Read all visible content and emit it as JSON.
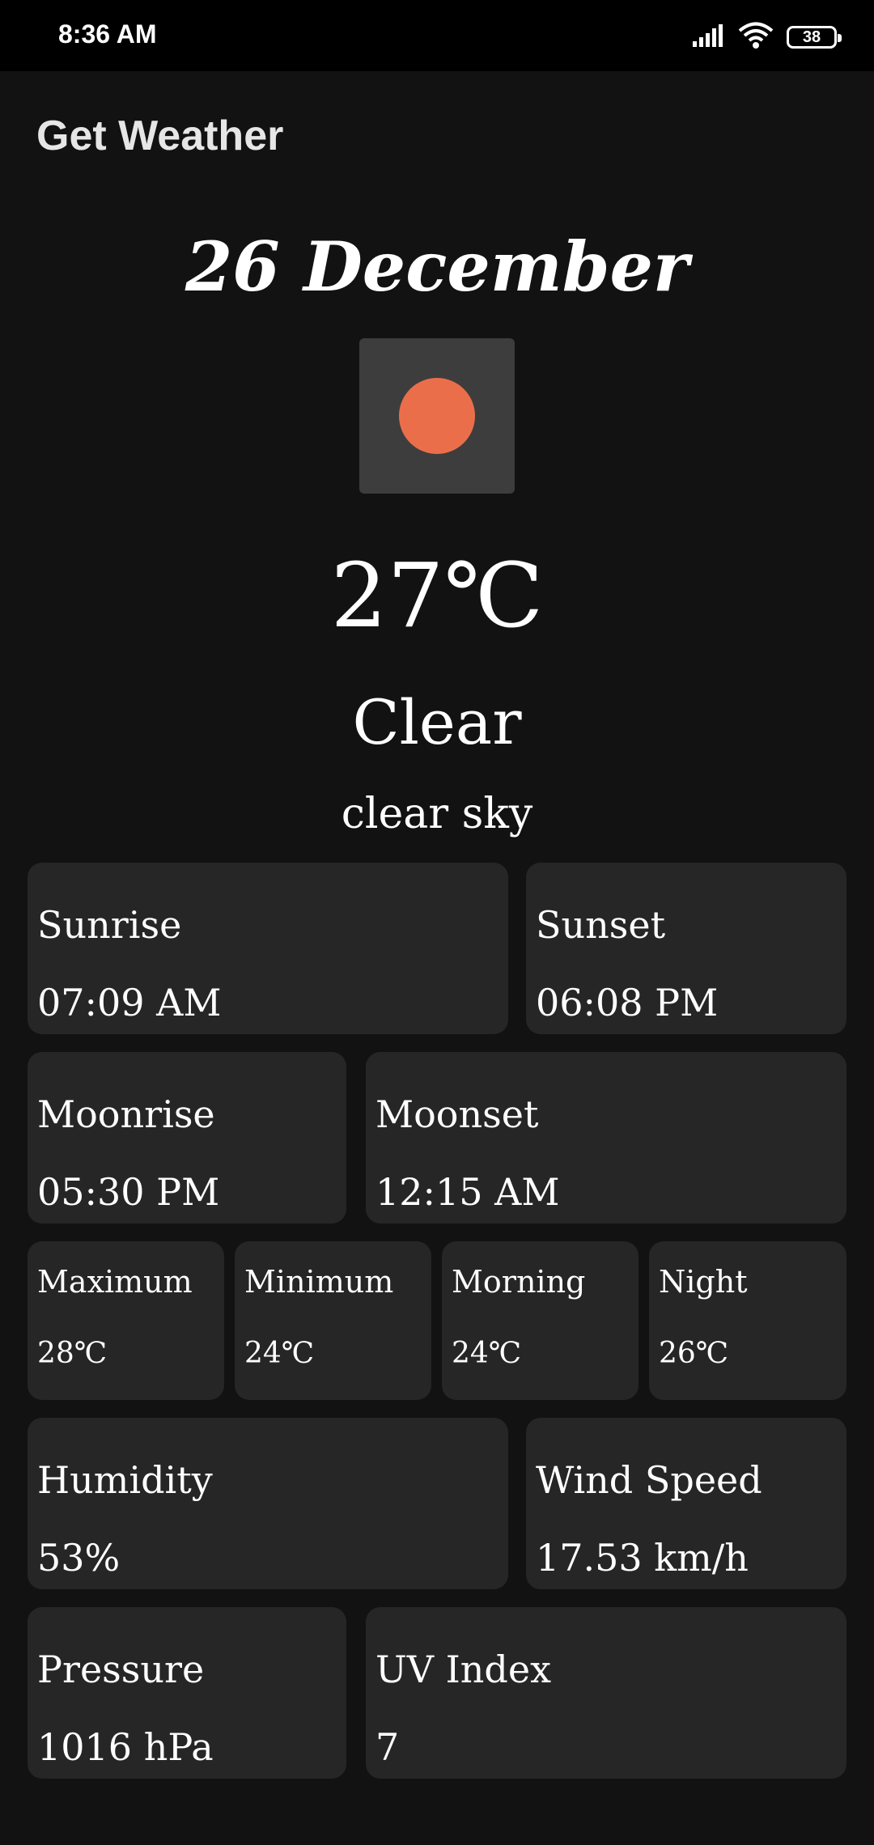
{
  "status_bar": {
    "time": "8:36 AM",
    "battery": "38",
    "icons": [
      "signal-icon",
      "wifi-icon",
      "battery-icon"
    ]
  },
  "app_bar": {
    "title": "Get Weather"
  },
  "weather": {
    "date": "26 December",
    "icon": "clear-sun-icon",
    "temperature": "27℃",
    "condition": "Clear",
    "description": "clear sky"
  },
  "details": {
    "sunrise": {
      "label": "Sunrise",
      "value": "07:09 AM"
    },
    "sunset": {
      "label": "Sunset",
      "value": "06:08 PM"
    },
    "moonrise": {
      "label": "Moonrise",
      "value": "05:30 PM"
    },
    "moonset": {
      "label": "Moonset",
      "value": "12:15 AM"
    },
    "maximum": {
      "label": "Maximum",
      "value": "28℃"
    },
    "minimum": {
      "label": "Minimum",
      "value": "24℃"
    },
    "morning": {
      "label": "Morning",
      "value": "24℃"
    },
    "night": {
      "label": "Night",
      "value": "26℃"
    },
    "humidity": {
      "label": "Humidity",
      "value": "53%"
    },
    "wind_speed": {
      "label": "Wind Speed",
      "value": "17.53 km/h"
    },
    "pressure": {
      "label": "Pressure",
      "value": "1016 hPa"
    },
    "uv_index": {
      "label": "UV Index",
      "value": "7"
    }
  },
  "colors": {
    "background": "#121212",
    "card": "#262626",
    "icon_box": "#3d3d3d",
    "sun": "#eb6e4b"
  }
}
